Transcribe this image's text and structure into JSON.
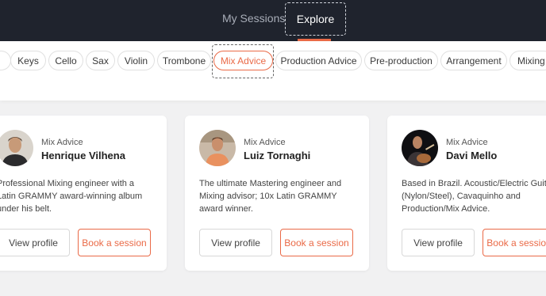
{
  "nav": {
    "my_sessions": "My Sessions",
    "explore": "Explore"
  },
  "filters": [
    {
      "label": "e",
      "active": false
    },
    {
      "label": "Keys",
      "active": false
    },
    {
      "label": "Cello",
      "active": false
    },
    {
      "label": "Sax",
      "active": false
    },
    {
      "label": "Violin",
      "active": false
    },
    {
      "label": "Trombone",
      "active": false
    },
    {
      "label": "Mix Advice",
      "active": true
    },
    {
      "label": "Production Advice",
      "active": false
    },
    {
      "label": "Pre-production",
      "active": false
    },
    {
      "label": "Arrangement",
      "active": false
    },
    {
      "label": "Mixing",
      "active": false
    }
  ],
  "cards": [
    {
      "category": "Mix Advice",
      "name": "Henrique Vilhena",
      "description": "Professional Mixing engineer with a\nLatin GRAMMY award-winning album\nunder his belt.",
      "view_label": "View profile",
      "book_label": "Book a session"
    },
    {
      "category": "Mix Advice",
      "name": "Luiz Tornaghi",
      "description": "The ultimate Mastering engineer and\nMixing advisor; 10x Latin GRAMMY\naward winner.",
      "view_label": "View profile",
      "book_label": "Book a session"
    },
    {
      "category": "Mix Advice",
      "name": "Davi Mello",
      "description": "Based in Brazil. Acoustic/Electric Guitar\n(Nylon/Steel), Cavaquinho and\nProduction/Mix Advice.",
      "view_label": "View profile",
      "book_label": "Book a session"
    }
  ],
  "colors": {
    "accent": "#ea6a47",
    "topbar": "#1f232d",
    "background": "#f1f1f2"
  }
}
